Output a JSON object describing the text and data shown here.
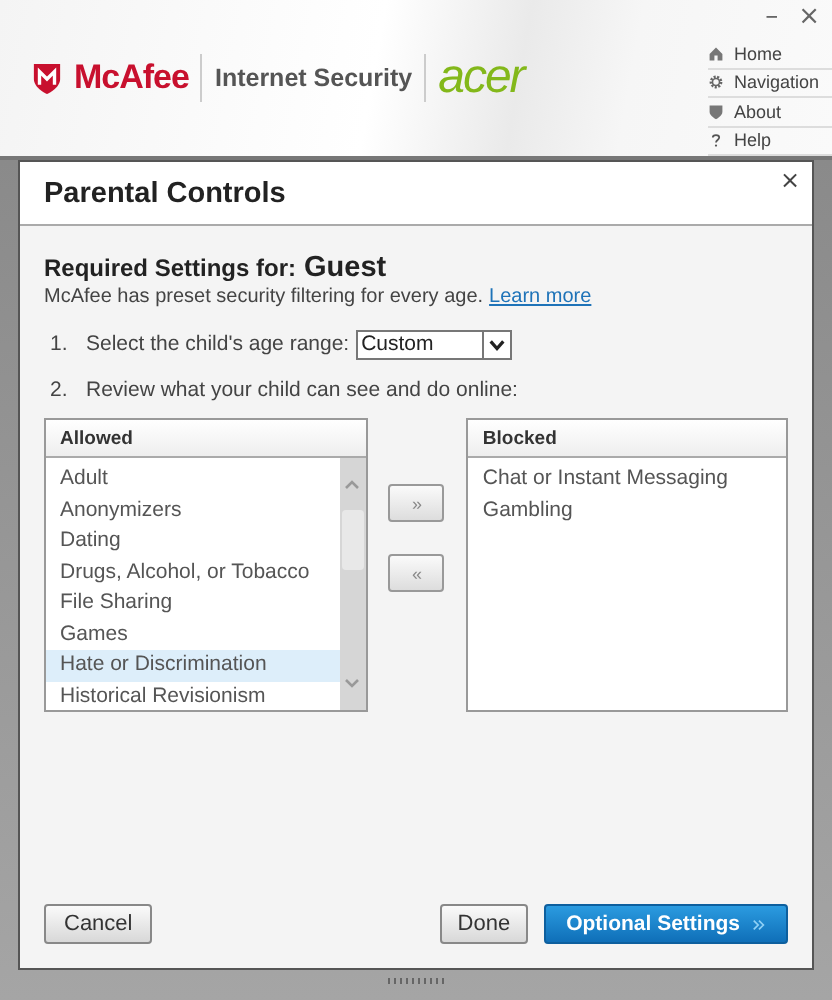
{
  "window_controls": [
    "–",
    "×"
  ],
  "header": {
    "brand": "McAfee",
    "product": "Internet Security",
    "partner": "acer",
    "nav": [
      {
        "kind": "home",
        "label": "Home"
      },
      {
        "kind": "settings",
        "label": "Navigation"
      },
      {
        "kind": "about",
        "label": "About"
      },
      {
        "kind": "help",
        "label": "Help"
      }
    ]
  },
  "dialog": {
    "title": "Parental Controls",
    "close": "×",
    "heading": "Required Settings for:",
    "user": "Guest",
    "description": "McAfee has preset security filtering for every age.",
    "link": "Learn more",
    "steps": [
      {
        "number": "1.",
        "label": "Select the child's age range:"
      },
      {
        "number": "2.",
        "label": "Review what your child can see and do online:"
      }
    ],
    "age_range": {
      "value": "Custom"
    },
    "allowed": {
      "header": "Allowed",
      "items": [
        {
          "label": "Adult",
          "selected": false
        },
        {
          "label": "Anonymizers",
          "selected": false
        },
        {
          "label": "Dating",
          "selected": false
        },
        {
          "label": "Drugs, Alcohol, or Tobacco",
          "selected": false
        },
        {
          "label": "File Sharing",
          "selected": false
        },
        {
          "label": "Games",
          "selected": false
        },
        {
          "label": "Hate or Discrimination",
          "selected": true
        },
        {
          "label": "Historical Revisionism",
          "selected": false
        }
      ]
    },
    "move_buttons": [
      "»",
      "«"
    ],
    "blocked": {
      "header": "Blocked",
      "items": [
        {
          "label": "Chat or Instant Messaging",
          "selected": false
        },
        {
          "label": "Gambling",
          "selected": false
        }
      ]
    },
    "buttons": [
      {
        "kind": "secondary",
        "label": "Cancel"
      },
      {
        "kind": "secondary",
        "label": "Done"
      },
      {
        "kind": "primary",
        "label": "Optional Settings"
      }
    ]
  }
}
